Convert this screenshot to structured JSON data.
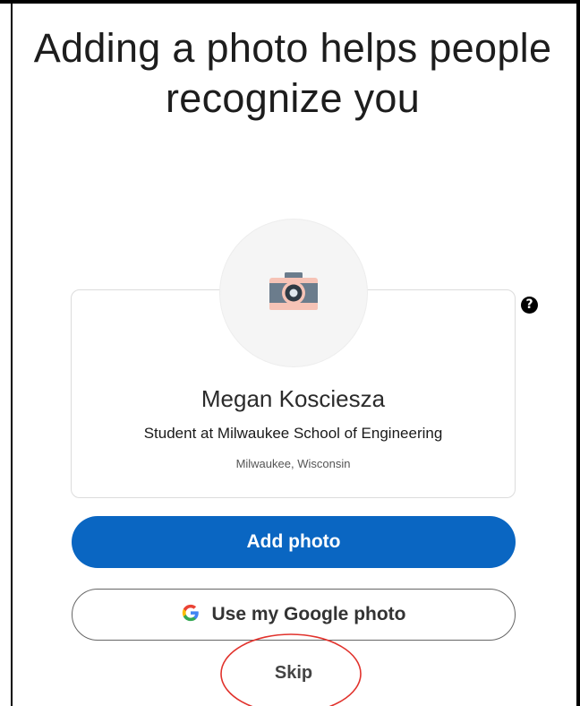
{
  "heading": "Adding a photo helps people recognize you",
  "help": {
    "icon": "question-circle-icon",
    "glyph": "?"
  },
  "profile": {
    "avatar_icon": "camera-icon",
    "name": "Megan Kosciesza",
    "headline": "Student at Milwaukee School of Engineering",
    "location": "Milwaukee, Wisconsin"
  },
  "actions": {
    "add_photo": "Add photo",
    "google_photo": "Use my Google photo",
    "google_icon": "google-g-icon",
    "skip": "Skip"
  },
  "colors": {
    "primary": "#0a66c2",
    "annotation": "#e1322c",
    "camera_body": "#f6c3b6",
    "camera_band": "#6b7c8c"
  }
}
